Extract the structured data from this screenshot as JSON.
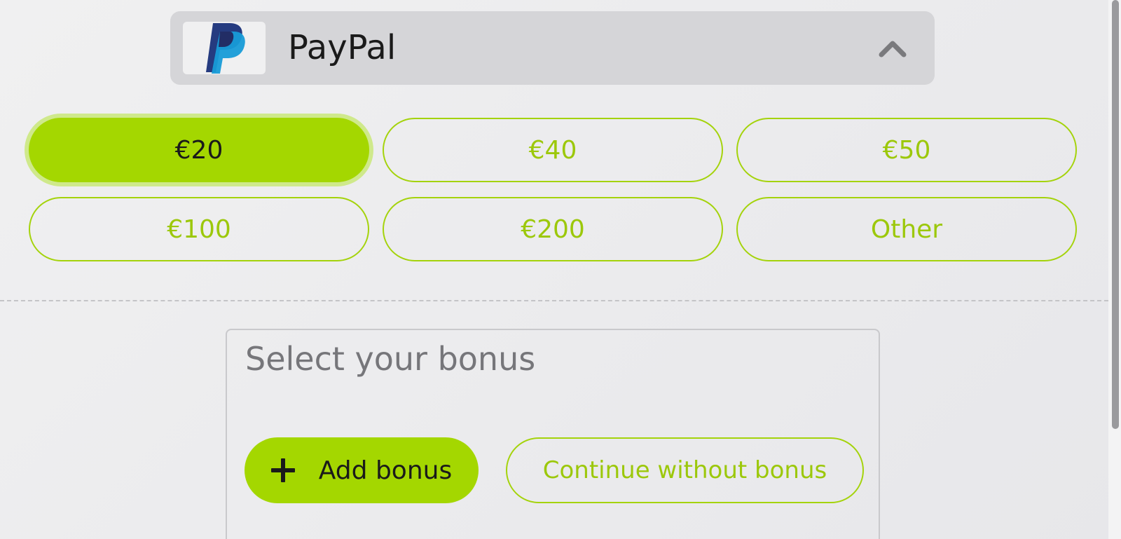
{
  "payment_method": {
    "name": "PayPal",
    "logo_icon": "paypal-logo",
    "expanded": true,
    "chevron_icon": "chevron-up-icon"
  },
  "amounts": [
    {
      "label": "€20",
      "selected": true
    },
    {
      "label": "€40",
      "selected": false
    },
    {
      "label": "€50",
      "selected": false
    },
    {
      "label": "€100",
      "selected": false
    },
    {
      "label": "€200",
      "selected": false
    },
    {
      "label": "Other",
      "selected": false
    }
  ],
  "bonus": {
    "title": "Select your bonus",
    "add_label": "Add bonus",
    "add_icon": "plus-icon",
    "continue_label": "Continue without bonus"
  },
  "colors": {
    "accent": "#a4d700",
    "accent_text": "#9cc80b",
    "header_bg": "#d5d5d8",
    "paypal_dark": "#253b80",
    "paypal_light": "#179bd7"
  }
}
